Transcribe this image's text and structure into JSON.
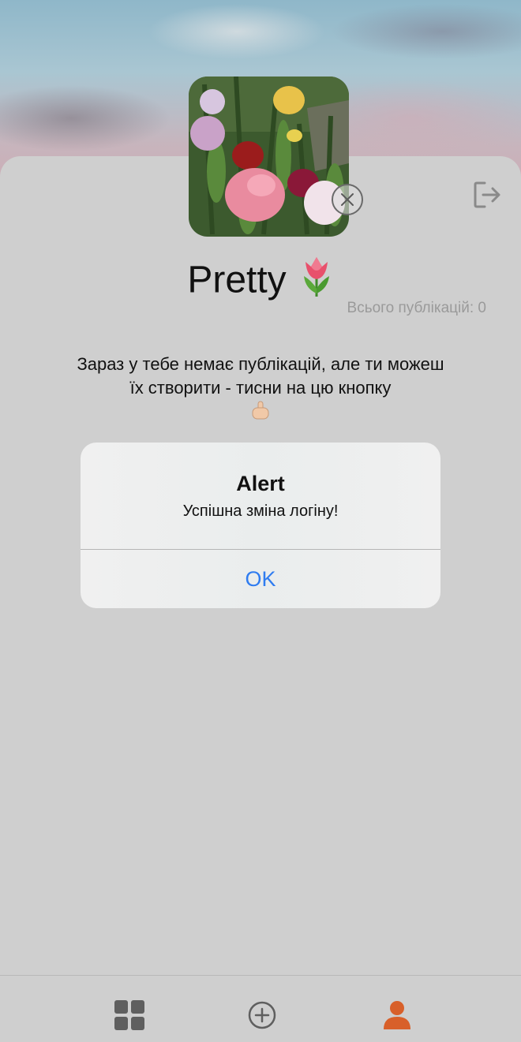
{
  "profile": {
    "username": "Pretty",
    "posts_count_text": "Всього публікацій: 0",
    "avatar_icon": "tulip-photo",
    "remove_avatar_icon": "close-icon",
    "logout_icon": "logout-icon"
  },
  "empty_state": {
    "message": "Зараз у тебе немає публікацій, але ти можеш їх створити - тисни на цю кнопку",
    "pointer_icon": "pointing-down-icon"
  },
  "alert": {
    "title": "Alert",
    "message": "Успішна зміна логіну!",
    "ok_label": "OK"
  },
  "tabbar": {
    "items": [
      {
        "icon": "grid-icon",
        "active": false
      },
      {
        "icon": "plus-circle-icon",
        "active": false
      },
      {
        "icon": "user-icon",
        "active": true
      }
    ],
    "active_color": "#d8602a",
    "inactive_color": "#5f5f5f"
  },
  "colors": {
    "accent": "#2f7cf0",
    "background": "#cfcfcf"
  }
}
